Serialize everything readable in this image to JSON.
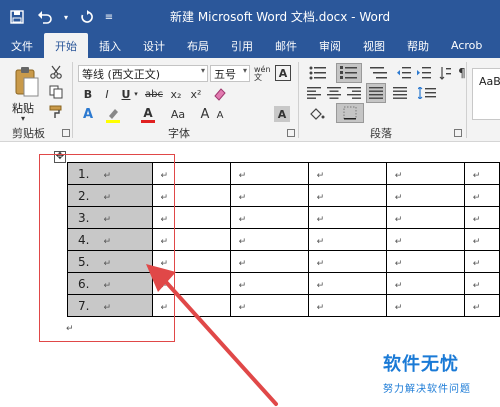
{
  "window": {
    "title": "新建 Microsoft Word 文档.docx  -  Word"
  },
  "quick_access": {
    "save_icon": "floppy-disk-icon",
    "undo_icon": "undo-icon",
    "redo_icon": "redo-icon"
  },
  "tabs": [
    {
      "label": "文件",
      "active": false
    },
    {
      "label": "开始",
      "active": true
    },
    {
      "label": "插入",
      "active": false
    },
    {
      "label": "设计",
      "active": false
    },
    {
      "label": "布局",
      "active": false
    },
    {
      "label": "引用",
      "active": false
    },
    {
      "label": "邮件",
      "active": false
    },
    {
      "label": "审阅",
      "active": false
    },
    {
      "label": "视图",
      "active": false
    },
    {
      "label": "帮助",
      "active": false
    },
    {
      "label": "Acrob",
      "active": false
    }
  ],
  "ribbon": {
    "clipboard": {
      "paste_label": "粘贴",
      "group_label": "剪贴板"
    },
    "font": {
      "font_name": "等线 (西文正文)",
      "font_size": "五号",
      "wen_label": "wén文",
      "group_label": "字体",
      "bold": "B",
      "italic": "I",
      "underline": "U",
      "strike": "abc",
      "subscript": "x₂",
      "superscript": "x²",
      "font_color": "A",
      "case": "Aa",
      "grow": "A",
      "shrink": "A",
      "char_a": "A"
    },
    "paragraph": {
      "group_label": "段落"
    },
    "styles": {
      "preview": "AaBb"
    }
  },
  "table": {
    "rows": [
      {
        "num": "1."
      },
      {
        "num": "2."
      },
      {
        "num": "3."
      },
      {
        "num": "4."
      },
      {
        "num": "5."
      },
      {
        "num": "6."
      },
      {
        "num": "7."
      }
    ],
    "para_mark": "↵"
  },
  "watermark": {
    "title": "软件无忧",
    "subtitle": "努力解决软件问题"
  },
  "colors": {
    "title_bar": "#2b579a",
    "ribbon_bg": "#f3f3f3",
    "selection_fill": "#c8c8c8",
    "annotation": "#e04848",
    "watermark": "#1a7ad6"
  }
}
